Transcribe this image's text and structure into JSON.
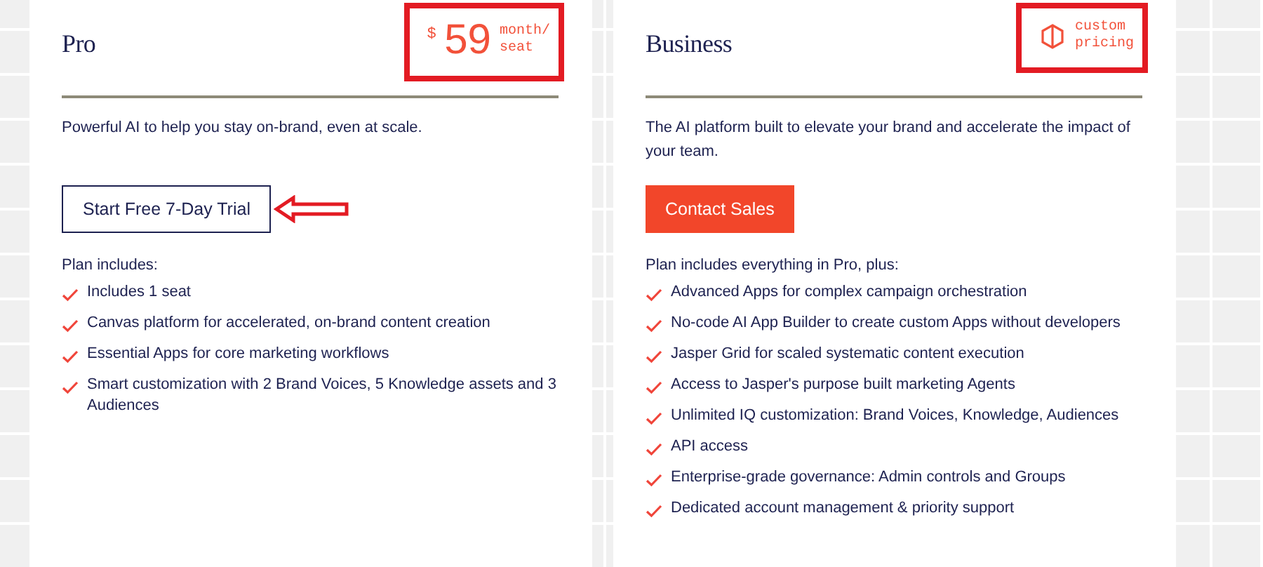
{
  "plans": [
    {
      "name": "Pro",
      "price": {
        "kind": "amount",
        "currency": "$",
        "amount": "59",
        "unit": [
          "month/",
          "seat"
        ]
      },
      "price_highlighted": true,
      "description": "Powerful AI to help you stay on-brand, even at scale.",
      "cta": {
        "label": "Start Free 7-Day Trial",
        "kind": "outline",
        "pointed_at": true
      },
      "includes_title": "Plan includes:",
      "features": [
        "Includes 1 seat",
        "Canvas platform for accelerated, on-brand content creation",
        "Essential Apps for core marketing workflows",
        "Smart customization with 2 Brand Voices, 5 Knowledge assets and 3 Audiences"
      ]
    },
    {
      "name": "Business",
      "price": {
        "kind": "custom",
        "unit": [
          "custom",
          "pricing"
        ]
      },
      "price_highlighted": true,
      "description": "The AI platform built to elevate your brand and accelerate the impact of your team.",
      "cta": {
        "label": "Contact Sales",
        "kind": "filled",
        "pointed_at": false
      },
      "includes_title": "Plan includes everything in Pro, plus:",
      "features": [
        "Advanced Apps for complex campaign orchestration",
        "No-code AI App Builder to create custom Apps without developers",
        "Jasper Grid for scaled systematic content execution",
        "Access to Jasper's purpose built marketing Agents",
        "Unlimited IQ customization: Brand Voices, Knowledge, Audiences",
        "API access",
        "Enterprise-grade governance: Admin controls and Groups",
        "Dedicated account management & priority support"
      ]
    }
  ]
}
